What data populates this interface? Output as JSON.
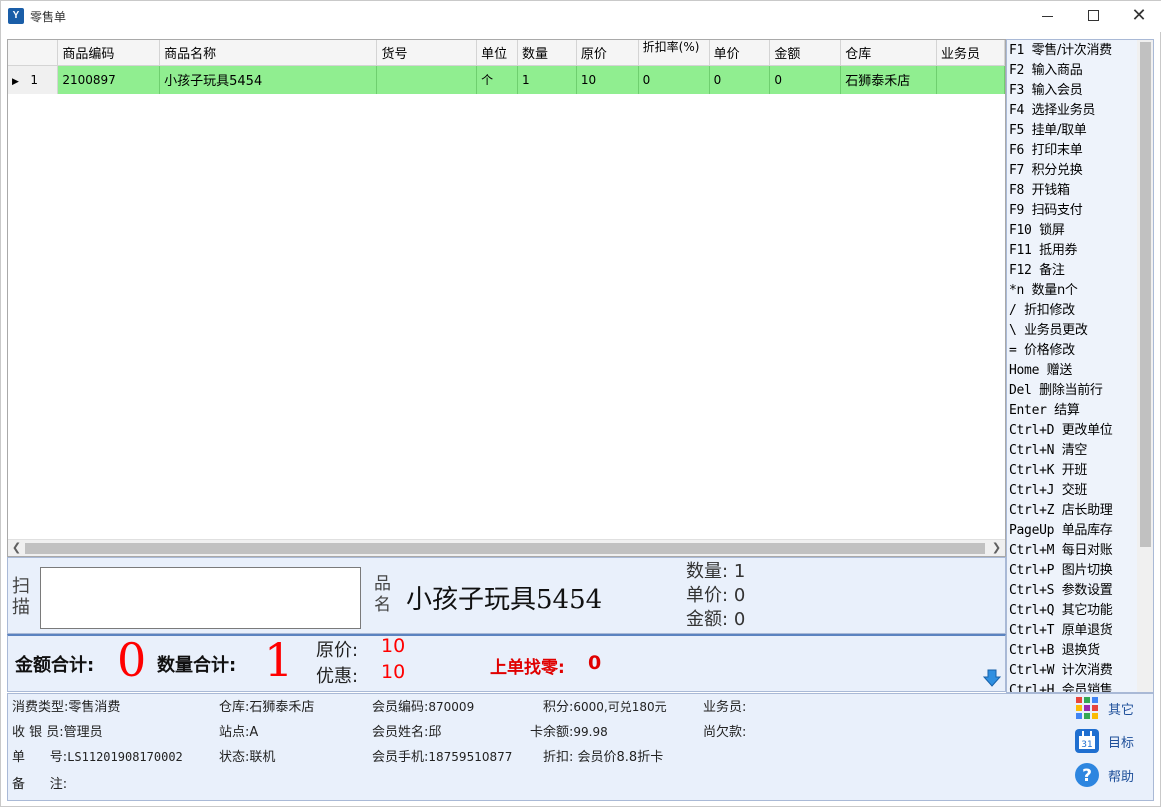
{
  "window": {
    "title": "零售单",
    "icon_text": "Y"
  },
  "grid": {
    "columns": [
      "",
      "商品编码",
      "商品名称",
      "货号",
      "单位",
      "数量",
      "原价",
      "折扣率(%)",
      "单价",
      "金额",
      "仓库",
      "业务员"
    ],
    "rows": [
      {
        "index": "1",
        "code": "2100897",
        "name": "小孩子玩具5454",
        "sku": "",
        "unit": "个",
        "qty": "1",
        "orig_price": "10",
        "discount": "0",
        "price": "0",
        "amount": "0",
        "warehouse": "石狮泰禾店",
        "salesman": ""
      }
    ]
  },
  "shortcuts": [
    {
      "key": "F1",
      "label": "零售/计次消费"
    },
    {
      "key": "F2",
      "label": "输入商品"
    },
    {
      "key": "F3",
      "label": "输入会员"
    },
    {
      "key": "F4",
      "label": "选择业务员"
    },
    {
      "key": "F5",
      "label": "挂单/取单"
    },
    {
      "key": "F6",
      "label": "打印末单"
    },
    {
      "key": "F7",
      "label": "积分兑换"
    },
    {
      "key": "F8",
      "label": "开钱箱"
    },
    {
      "key": "F9",
      "label": "扫码支付"
    },
    {
      "key": "F10",
      "label": "锁屏"
    },
    {
      "key": "F11",
      "label": "抵用券"
    },
    {
      "key": "F12",
      "label": "备注"
    },
    {
      "key": "*n",
      "label": " 数量n个"
    },
    {
      "key": "/",
      "label": "折扣修改"
    },
    {
      "key": "\\",
      "label": "业务员更改"
    },
    {
      "key": "=",
      "label": "价格修改"
    },
    {
      "key": "Home",
      "label": "赠送"
    },
    {
      "key": "Del",
      "label": "删除当前行"
    },
    {
      "key": "Enter",
      "label": "结算"
    },
    {
      "key": "Ctrl+D",
      "label": "更改单位"
    },
    {
      "key": "Ctrl+N",
      "label": "清空"
    },
    {
      "key": "Ctrl+K",
      "label": "开班"
    },
    {
      "key": "Ctrl+J",
      "label": "交班"
    },
    {
      "key": "Ctrl+Z",
      "label": "店长助理"
    },
    {
      "key": "PageUp",
      "label": "单品库存"
    },
    {
      "key": "Ctrl+M",
      "label": "每日对账"
    },
    {
      "key": "Ctrl+P",
      "label": "图片切换"
    },
    {
      "key": "Ctrl+S",
      "label": "参数设置"
    },
    {
      "key": "Ctrl+Q",
      "label": "其它功能"
    },
    {
      "key": "Ctrl+T",
      "label": "原单退货"
    },
    {
      "key": "Ctrl+B",
      "label": "退换货"
    },
    {
      "key": "Ctrl+W",
      "label": "计次消费"
    },
    {
      "key": "Ctrl+H",
      "label": "会员销售"
    }
  ],
  "scan": {
    "scan_label": "扫描",
    "name_label": "品名",
    "product_name": "小孩子玩具5454",
    "qty_label": "数量:",
    "qty_value": "1",
    "price_label": "单价:",
    "price_value": "0",
    "amount_label": "金额:",
    "amount_value": "0"
  },
  "totals": {
    "amount_label": "金额合计:",
    "amount_value": "0",
    "qty_label": "数量合计:",
    "qty_value": "1",
    "orig_label": "原价:",
    "orig_value": "10",
    "discount_label": "优惠:",
    "discount_value": "10",
    "change_label": "上单找零:",
    "change_value": "0"
  },
  "info": {
    "consume_type_label": "消费类型:",
    "consume_type": "零售消费",
    "cashier_label": "收 银 员:",
    "cashier": "管理员",
    "order_no_label": "单      号:",
    "order_no": "LS11201908170002",
    "note_label": "备      注:",
    "note": "",
    "warehouse_label": "仓库:",
    "warehouse": "石狮泰禾店",
    "site_label": "站点:",
    "site": "A",
    "status_label": "状态:",
    "status": "联机",
    "member_code_label": "会员编码:",
    "member_code": "870009",
    "member_name_label": "会员姓名:",
    "member_name": "邱",
    "member_phone_label": "会员手机:",
    "member_phone": "18759510877",
    "points_label": "积分:",
    "points": "6000,可兑180元",
    "card_balance_label": "卡余额:",
    "card_balance": "99.98",
    "discount_label": "折扣:",
    "discount": " 会员价8.8折卡",
    "salesman_label": "业务员:",
    "salesman": "",
    "debt_label": "尚欠款:",
    "debt": ""
  },
  "side_buttons": {
    "other": "其它",
    "target": "目标",
    "help": "帮助"
  },
  "colors": {
    "row_selected": "#90ee90",
    "accent_red": "#ff0000",
    "panel_bg": "#e9f0fb"
  }
}
